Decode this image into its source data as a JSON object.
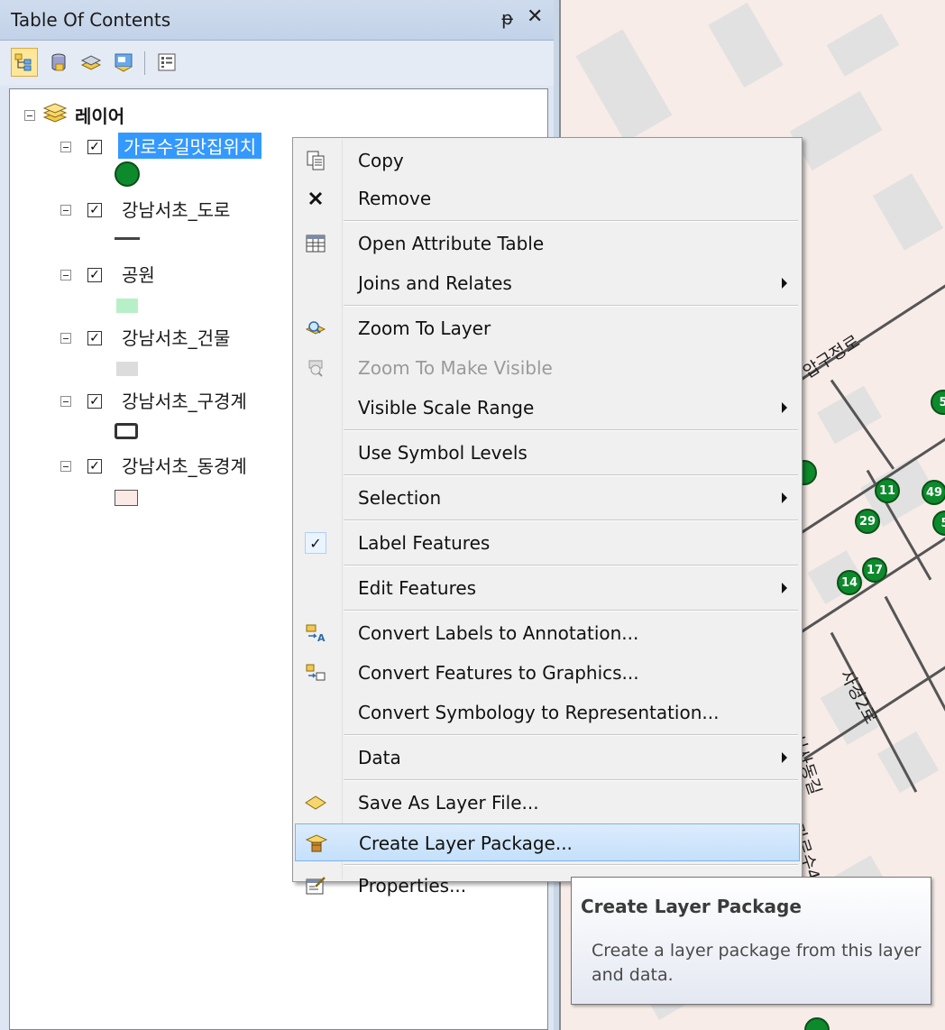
{
  "toc": {
    "title": "Table Of Contents",
    "pin_glyph": "ᵽ",
    "close_glyph": "✕",
    "toolbar": [
      "list-by-drawing-order-icon",
      "list-by-source-icon",
      "list-by-visibility-icon",
      "list-by-selection-icon",
      "options-icon"
    ],
    "group_label": "레이어",
    "layers": [
      {
        "name": "가로수길맛집위치",
        "checked": true,
        "symbol": "green-circle"
      },
      {
        "name": "강남서초_도로",
        "checked": true,
        "symbol": "dash-line"
      },
      {
        "name": "공원",
        "checked": true,
        "symbol": "light-green-fill"
      },
      {
        "name": "강남서초_건물",
        "checked": true,
        "symbol": "gray-fill"
      },
      {
        "name": "강남서초_구경계",
        "checked": true,
        "symbol": "thick-outline"
      },
      {
        "name": "강남서초_동경계",
        "checked": true,
        "symbol": "pink-fill"
      }
    ]
  },
  "menu": {
    "items": [
      {
        "label": "Copy",
        "icon": "copy-icon"
      },
      {
        "label": "Remove",
        "icon": "remove-icon"
      },
      {
        "label": "Open Attribute Table",
        "icon": "table-icon"
      },
      {
        "label": "Joins and Relates",
        "submenu": true
      },
      {
        "label": "Zoom To Layer",
        "icon": "zoom-layer-icon"
      },
      {
        "label": "Zoom To Make Visible",
        "icon": "zoom-visible-icon",
        "disabled": true
      },
      {
        "label": "Visible Scale Range",
        "submenu": true
      },
      {
        "label": "Use Symbol Levels"
      },
      {
        "label": "Selection",
        "submenu": true
      },
      {
        "label": "Label Features",
        "checked": true
      },
      {
        "label": "Edit Features",
        "submenu": true
      },
      {
        "label": "Convert Labels to Annotation...",
        "icon": "convert-labels-icon"
      },
      {
        "label": "Convert Features to Graphics...",
        "icon": "convert-features-icon"
      },
      {
        "label": "Convert Symbology to Representation..."
      },
      {
        "label": "Data",
        "submenu": true
      },
      {
        "label": "Save As Layer File...",
        "icon": "save-layer-icon"
      },
      {
        "label": "Create Layer Package...",
        "icon": "layer-package-icon",
        "highlighted": true
      },
      {
        "label": "Properties...",
        "icon": "properties-icon"
      }
    ]
  },
  "tooltip": {
    "title": "Create Layer Package",
    "description": "Create a layer package from this layer and data."
  },
  "map": {
    "road_labels": [
      "압구정로",
      "신사동길",
      "가로수4길",
      "사경2로"
    ],
    "poi_labels": [
      "5",
      "11",
      "49",
      "5",
      "29",
      "14",
      "17"
    ]
  }
}
